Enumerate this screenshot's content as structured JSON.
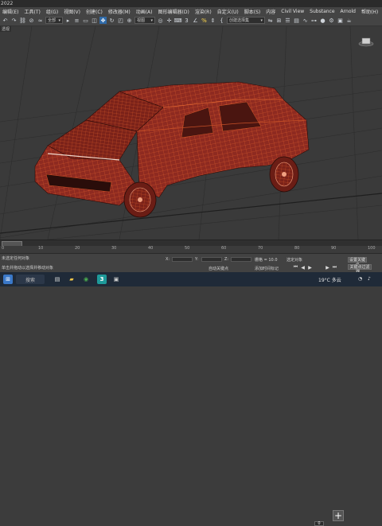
{
  "title": "2022",
  "menu": [
    "编辑(E)",
    "工具(T)",
    "组(G)",
    "视图(V)",
    "创建(C)",
    "修改器(M)",
    "动画(A)",
    "图形编辑器(D)",
    "渲染(R)",
    "自定义(U)",
    "脚本(S)",
    "内容",
    "Civil View",
    "Substance",
    "Arnold",
    "帮助(H)"
  ],
  "toolbar": {
    "selection_filter": "全部",
    "view_dropdown": "视图",
    "named_selection": "创建选择集",
    "percent_icon": "%"
  },
  "viewport": {
    "label": "透视",
    "wire_color": "#e0602e",
    "body_color": "#8e2a20"
  },
  "timeline": {
    "ticks": [
      "0",
      "10",
      "20",
      "30",
      "40",
      "50",
      "60",
      "70",
      "80",
      "90",
      "100"
    ]
  },
  "status": {
    "prompt": "未选定任何对象",
    "x_label": "X:",
    "y_label": "Y:",
    "z_label": "Z:",
    "grid": "栅格 = 10.0",
    "autokey": "自动关键点",
    "selected": "选定对象",
    "set_key": "设置关键点",
    "key_filters": "关键点过滤器...",
    "time_tag": "添加时间标记",
    "frame": "0",
    "hint": "单击并拖动以选择并移动对象"
  },
  "taskbar": {
    "search": "搜索",
    "weather": "19°C 多云",
    "icons": [
      "start-icon",
      "search-icon",
      "task-view-icon",
      "explorer-icon",
      "chrome-icon",
      "3dsmax-icon"
    ]
  }
}
